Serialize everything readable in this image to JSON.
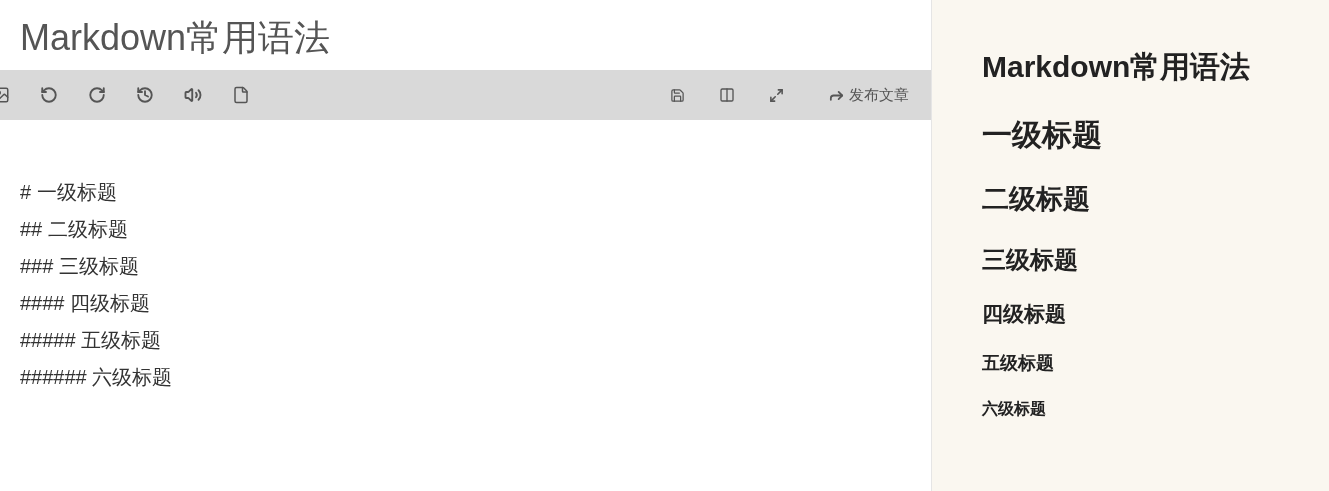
{
  "title": "Markdown常用语法",
  "toolbar": {
    "publish_label": "发布文章"
  },
  "editor": {
    "lines": [
      "# 一级标题",
      "## 二级标题",
      "### 三级标题",
      "#### 四级标题",
      "##### 五级标题",
      "###### 六级标题"
    ]
  },
  "preview": {
    "headings": [
      {
        "kind": "h1",
        "text": "Markdown常用语法"
      },
      {
        "kind": "h1",
        "text": "一级标题"
      },
      {
        "kind": "h2",
        "text": "二级标题"
      },
      {
        "kind": "h3",
        "text": "三级标题"
      },
      {
        "kind": "h4",
        "text": "四级标题"
      },
      {
        "kind": "h5",
        "text": "五级标题"
      },
      {
        "kind": "h6",
        "text": "六级标题"
      }
    ]
  }
}
